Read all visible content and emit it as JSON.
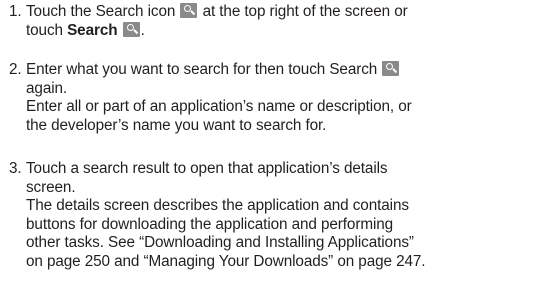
{
  "steps": [
    {
      "number": "1.",
      "line1_a": "Touch the Search icon",
      "line1_icon": "search-icon",
      "line1_b": "at the top right of the screen or",
      "line2_a": "touch",
      "line2_bold": "Search",
      "line2_icon": "search-icon",
      "line2_b": "."
    },
    {
      "number": "2.",
      "line1_a": "Enter what you want to search for then touch Search",
      "line1_icon": "search-icon",
      "line2": "again.",
      "line3": "Enter all or part of an application’s name or description, or",
      "line4": "the developer’s name you want to search for."
    },
    {
      "number": "3.",
      "lines": [
        "Touch a search result to open that application’s details",
        "screen.",
        "The details screen describes the application and contains",
        "buttons for downloading the application and performing",
        "other tasks. See “Downloading and Installing Applications”",
        "on page 250 and “Managing Your Downloads” on page 247."
      ]
    }
  ]
}
